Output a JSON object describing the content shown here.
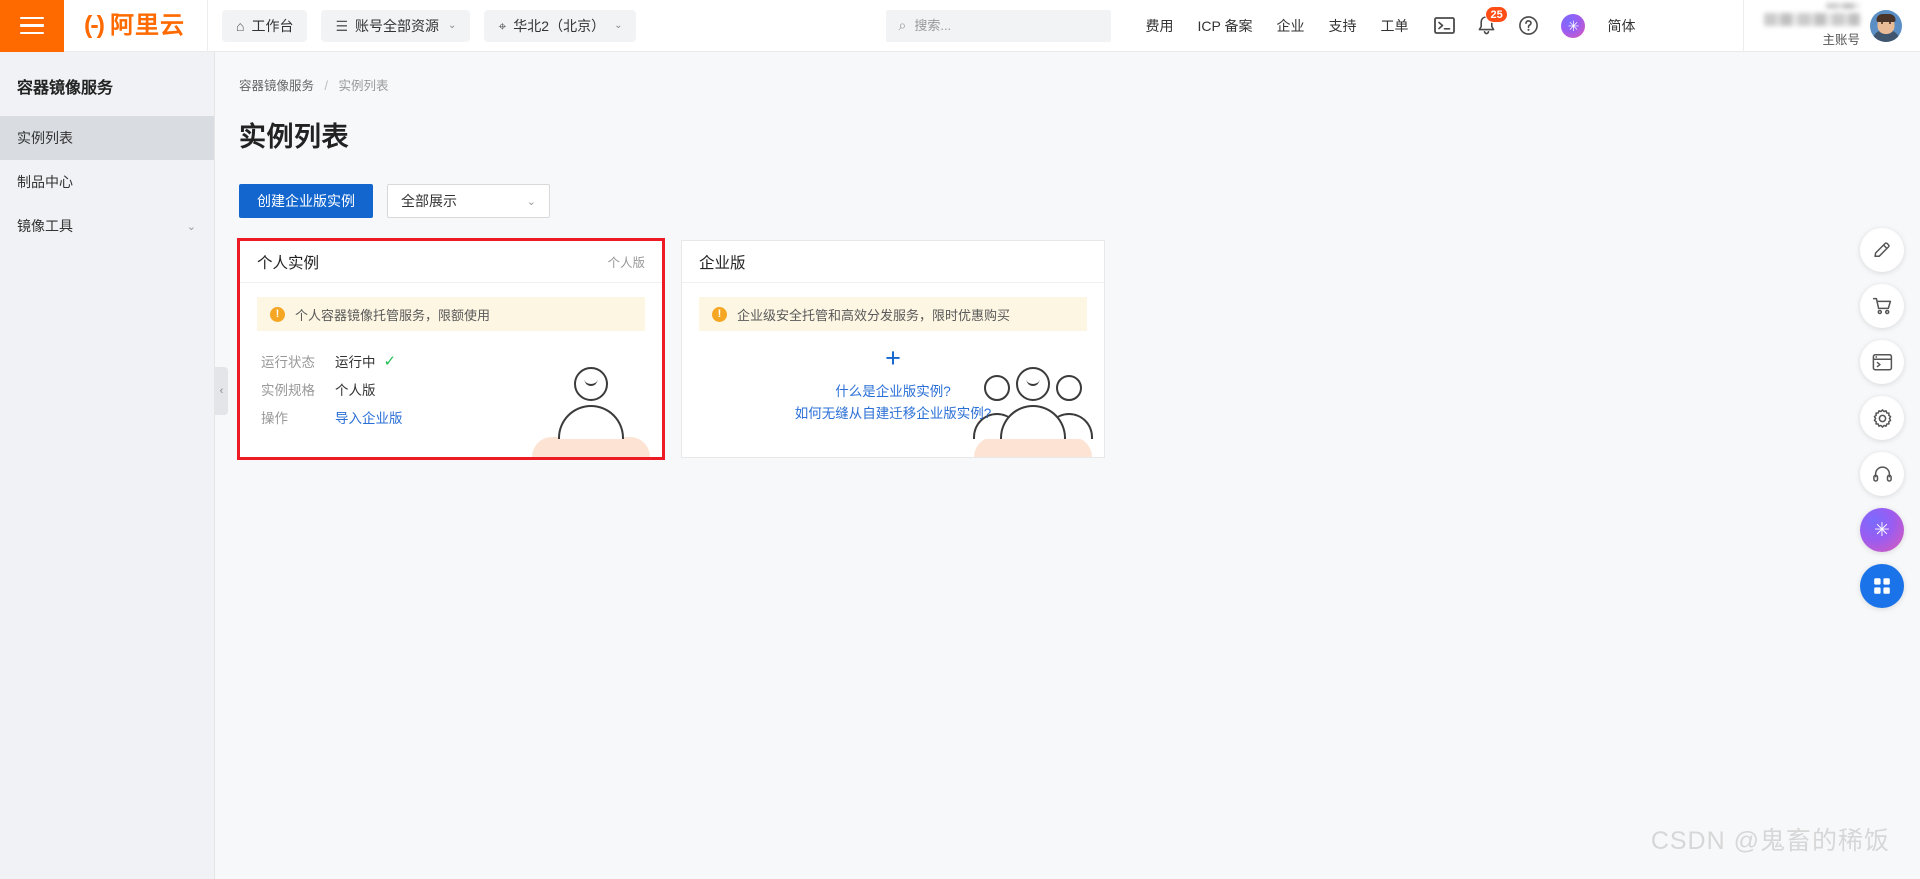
{
  "header": {
    "menu_icon": "hamburger-icon",
    "logo_mark": "(-)",
    "logo_text": "阿里云",
    "workbench": {
      "label": "工作台",
      "icon": "home-icon"
    },
    "resources": {
      "label": "账号全部资源",
      "icon": "resource-icon",
      "chevron": "⌄"
    },
    "region": {
      "label": "华北2（北京）",
      "icon": "location-icon",
      "chevron": "⌄"
    },
    "search": {
      "placeholder": "搜索...",
      "value": "",
      "icon": "search-icon"
    },
    "links": [
      "费用",
      "ICP 备案",
      "企业",
      "支持",
      "工单"
    ],
    "icons": {
      "console": "terminal-icon",
      "notification": "bell-icon",
      "notification_badge": "25",
      "help": "question-circle-icon",
      "ai_assistant": "ai-sparkle-icon"
    },
    "language": "简体",
    "user": {
      "account_type": "主账号",
      "avatar": "user-avatar"
    }
  },
  "sidebar": {
    "title": "容器镜像服务",
    "items": [
      {
        "label": "实例列表",
        "active": true,
        "chevron": ""
      },
      {
        "label": "制品中心",
        "active": false,
        "chevron": ""
      },
      {
        "label": "镜像工具",
        "active": false,
        "chevron": "⌄"
      }
    ],
    "collapse_handle": "‹"
  },
  "main": {
    "breadcrumb": {
      "root": "容器镜像服务",
      "separator": "/",
      "current": "实例列表"
    },
    "page_title": "实例列表",
    "toolbar": {
      "create_button": "创建企业版实例",
      "filter_value": "全部展示",
      "filter_chevron": "⌄"
    },
    "cards": [
      {
        "title": "个人实例",
        "tag": "个人版",
        "alert": "个人容器镜像托管服务，限额使用",
        "alert_icon": "warning-icon",
        "rows": [
          {
            "key": "运行状态",
            "value": "运行中",
            "check": "✓"
          },
          {
            "key": "实例规格",
            "value": "个人版"
          },
          {
            "key": "操作",
            "link": "导入企业版"
          }
        ]
      },
      {
        "title": "企业版",
        "alert": "企业级安全托管和高效分发服务，限时优惠购买",
        "alert_icon": "warning-icon",
        "plus": "+",
        "links": [
          "什么是企业版实例?",
          "如何无缝从自建迁移企业版实例?"
        ]
      }
    ]
  },
  "float_toolbar": [
    {
      "name": "edit-pencil-icon",
      "glyph": "✎"
    },
    {
      "name": "shopping-cart-icon",
      "glyph": "⛒"
    },
    {
      "name": "console-window-icon",
      "glyph": "▣"
    },
    {
      "name": "gear-settings-icon",
      "glyph": "⚙"
    },
    {
      "name": "headset-support-icon",
      "glyph": "◠"
    },
    {
      "name": "ai-sparkle-icon",
      "glyph": "✳"
    },
    {
      "name": "apps-grid-icon",
      "glyph": "⊞"
    }
  ],
  "watermark": "CSDN @鬼畜的稀饭"
}
